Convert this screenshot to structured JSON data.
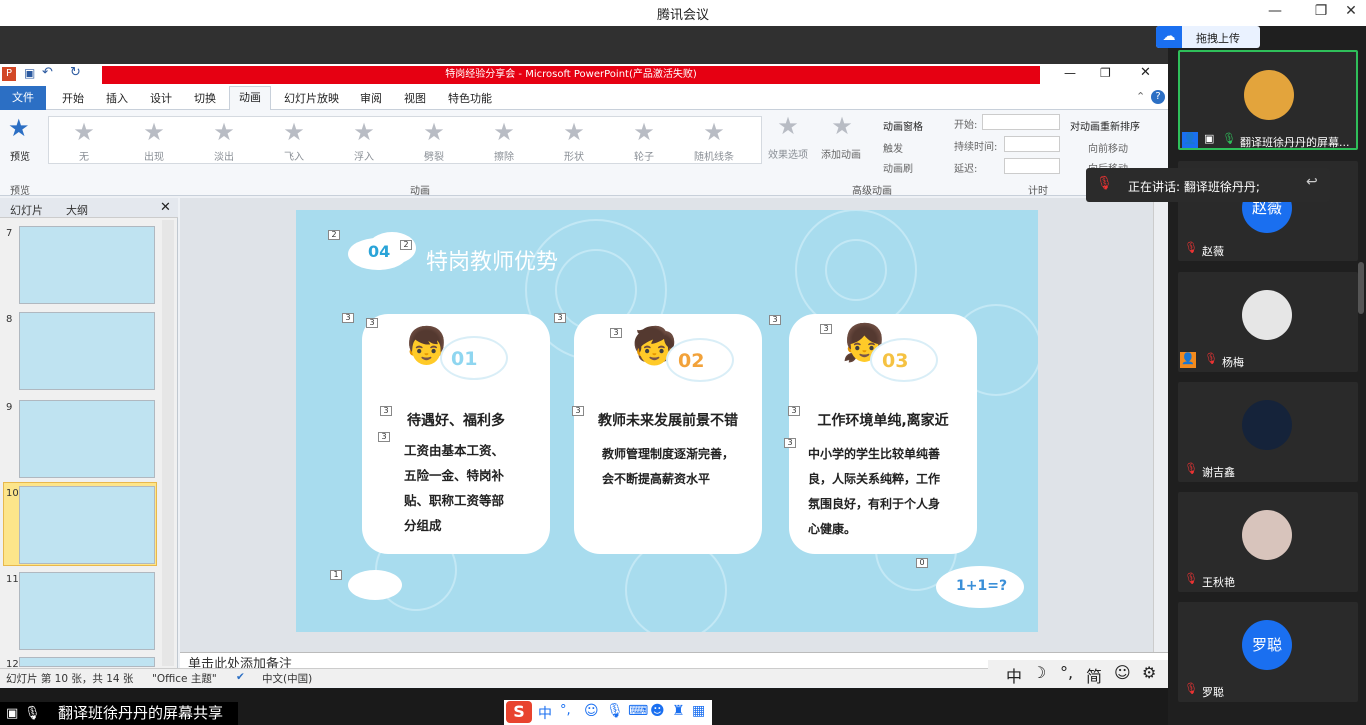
{
  "window": {
    "title": "腾讯会议"
  },
  "powerpoint": {
    "title": "特岗经验分享会 - Microsoft PowerPoint(产品激活失败)",
    "file_tab": "文件",
    "tabs": [
      "开始",
      "插入",
      "设计",
      "切换",
      "动画",
      "幻灯片放映",
      "审阅",
      "视图",
      "特色功能"
    ],
    "active_tab": "动画",
    "preview_label": "预览",
    "preview_group": "预览",
    "animations": [
      "无",
      "出现",
      "淡出",
      "飞入",
      "浮入",
      "劈裂",
      "擦除",
      "形状",
      "轮子",
      "随机线条"
    ],
    "effect_options": "效果选项",
    "animation_group": "动画",
    "add_animation": "添加动画",
    "animation_pane": "动画窗格",
    "trigger": "触发",
    "painter": "动画刷",
    "advanced_group": "高级动画",
    "start_label": "开始:",
    "duration_label": "持续时间:",
    "delay_label": "延迟:",
    "timing_group": "计时",
    "reorder_label": "对动画重新排序",
    "move_earlier": "向前移动",
    "move_later": "向后移动",
    "panel_tabs": [
      "幻灯片",
      "大纲"
    ],
    "slide_numbers": [
      "7",
      "8",
      "9",
      "10",
      "11",
      "12"
    ],
    "notes_placeholder": "单击此处添加备注",
    "status": {
      "slide_info": "幻灯片 第 10 张，共 14 张",
      "theme": "\"Office 主题\"",
      "language": "中文(中国)"
    }
  },
  "slide": {
    "section_number": "04",
    "title": "特岗教师优势",
    "cards": [
      {
        "num": "01",
        "heading": "待遇好、福利多",
        "body": [
          "工资由基本工资、",
          "五险一金、特岗补",
          "贴、职称工资等部",
          "分组成"
        ]
      },
      {
        "num": "02",
        "heading": "教师未来发展前景不错",
        "body": [
          "教师管理制度逐渐完善，",
          "会不断提高薪资水平"
        ]
      },
      {
        "num": "03",
        "heading": "工作环境单纯,离家近",
        "body": [
          "中小学的学生比较单纯善",
          "良，人际关系纯粹，工作",
          "氛围良好，有利于个人身",
          "心健康。"
        ]
      }
    ],
    "corner_text": "1+1=?",
    "tags": [
      "2",
      "2",
      "3",
      "3",
      "3",
      "3",
      "3",
      "3",
      "3",
      "3",
      "3",
      "3",
      "3",
      "1",
      "0"
    ]
  },
  "ime": {
    "chars": [
      "中",
      "☽",
      "°,",
      "简",
      "☺",
      "⚙"
    ]
  },
  "sogou_ime": {
    "logo": "S",
    "mode": "中",
    "punct": "°,"
  },
  "meeting": {
    "upload_button": "拖拽上传",
    "speaking": "正在讲话: 翻译班徐丹丹;",
    "screen_share_label": "翻译班徐丹丹的屏幕共享",
    "participants": [
      {
        "name": "翻译班徐丹丹的屏幕...",
        "muted": false,
        "avatar": "cartoon"
      },
      {
        "name": "赵薇",
        "muted": true,
        "avatar_text": "赵薇"
      },
      {
        "name": "杨梅",
        "muted": true,
        "avatar": "photo"
      },
      {
        "name": "谢吉鑫",
        "muted": true,
        "avatar": "moon"
      },
      {
        "name": "王秋艳",
        "muted": true,
        "avatar": "photo"
      },
      {
        "name": "罗聪",
        "muted": true,
        "avatar_text": "罗聪"
      }
    ]
  },
  "colors": {
    "accent_blue": "#1a6ff0",
    "ppt_red": "#e60012",
    "slide_bg": "#a8dcee",
    "num_blue": "#8fd6f0",
    "num_orange": "#f2a23a",
    "num_yellow": "#f5c242"
  }
}
